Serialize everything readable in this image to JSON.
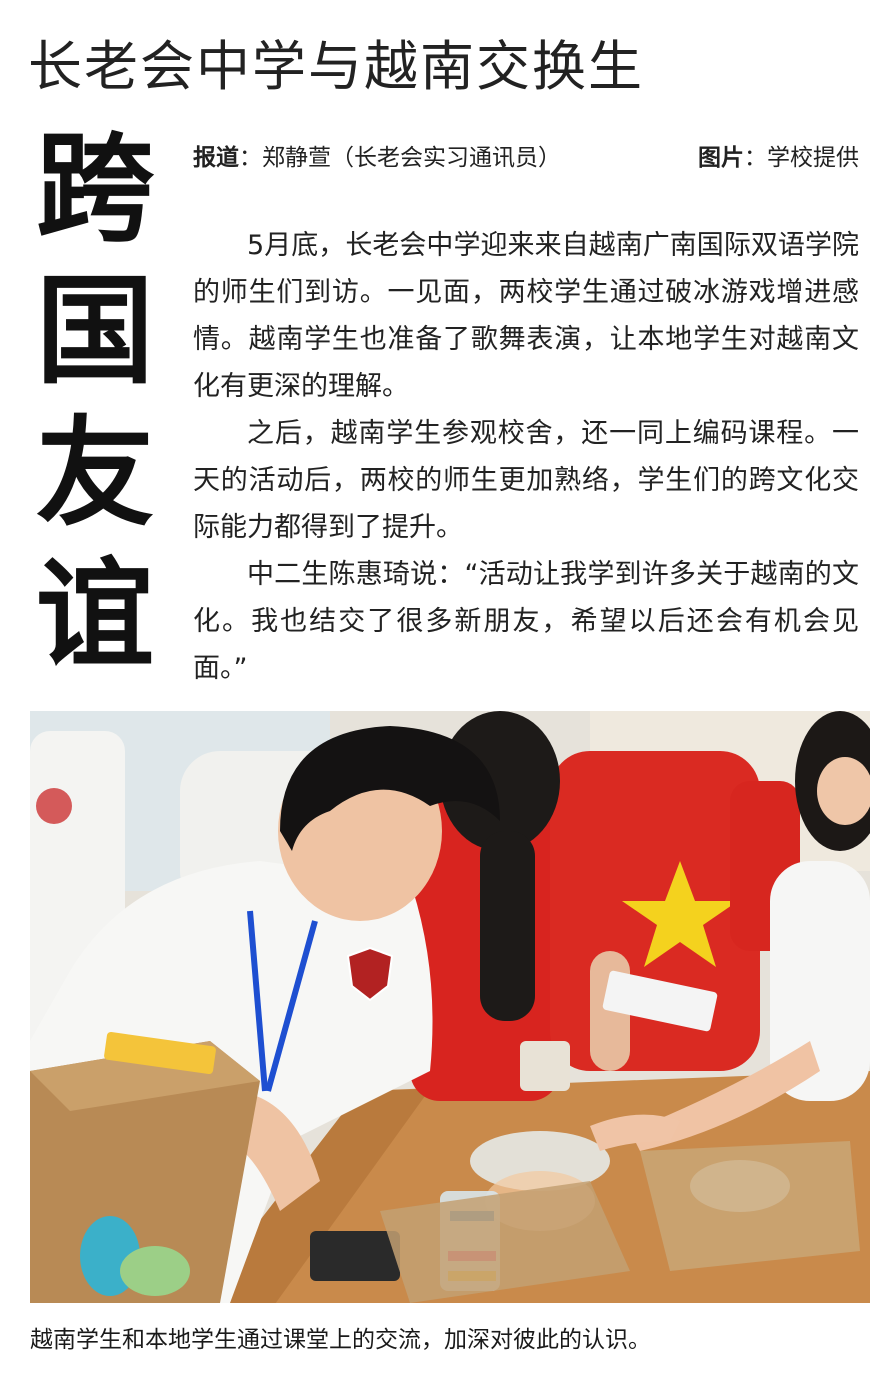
{
  "kicker": "长老会中学与越南交换生",
  "headline_chars": [
    "跨",
    "国",
    "友",
    "谊"
  ],
  "byline": {
    "reporter_label": "报道",
    "reporter_value": "：郑静萱（长老会实习通讯员）",
    "photo_label": "图片",
    "photo_value": "：学校提供"
  },
  "paragraphs": [
    "5月底，长老会中学迎来来自越南广南国际双语学院的师生们到访。一见面，两校学生通过破冰游戏增进感情。越南学生也准备了歌舞表演，让本地学生对越南文化有更深的理解。",
    "之后，越南学生参观校舍，还一同上编码课程。一天的活动后，两校的师生更加熟络，学生们的跨文化交际能力都得到了提升。",
    "中二生陈惠琦说：“活动让我学到许多关于越南的文化。我也结交了很多新朋友，希望以后还会有机会见面。”"
  ],
  "photo_caption": "越南学生和本地学生通过课堂上的交流，加深对彼此的认识。"
}
